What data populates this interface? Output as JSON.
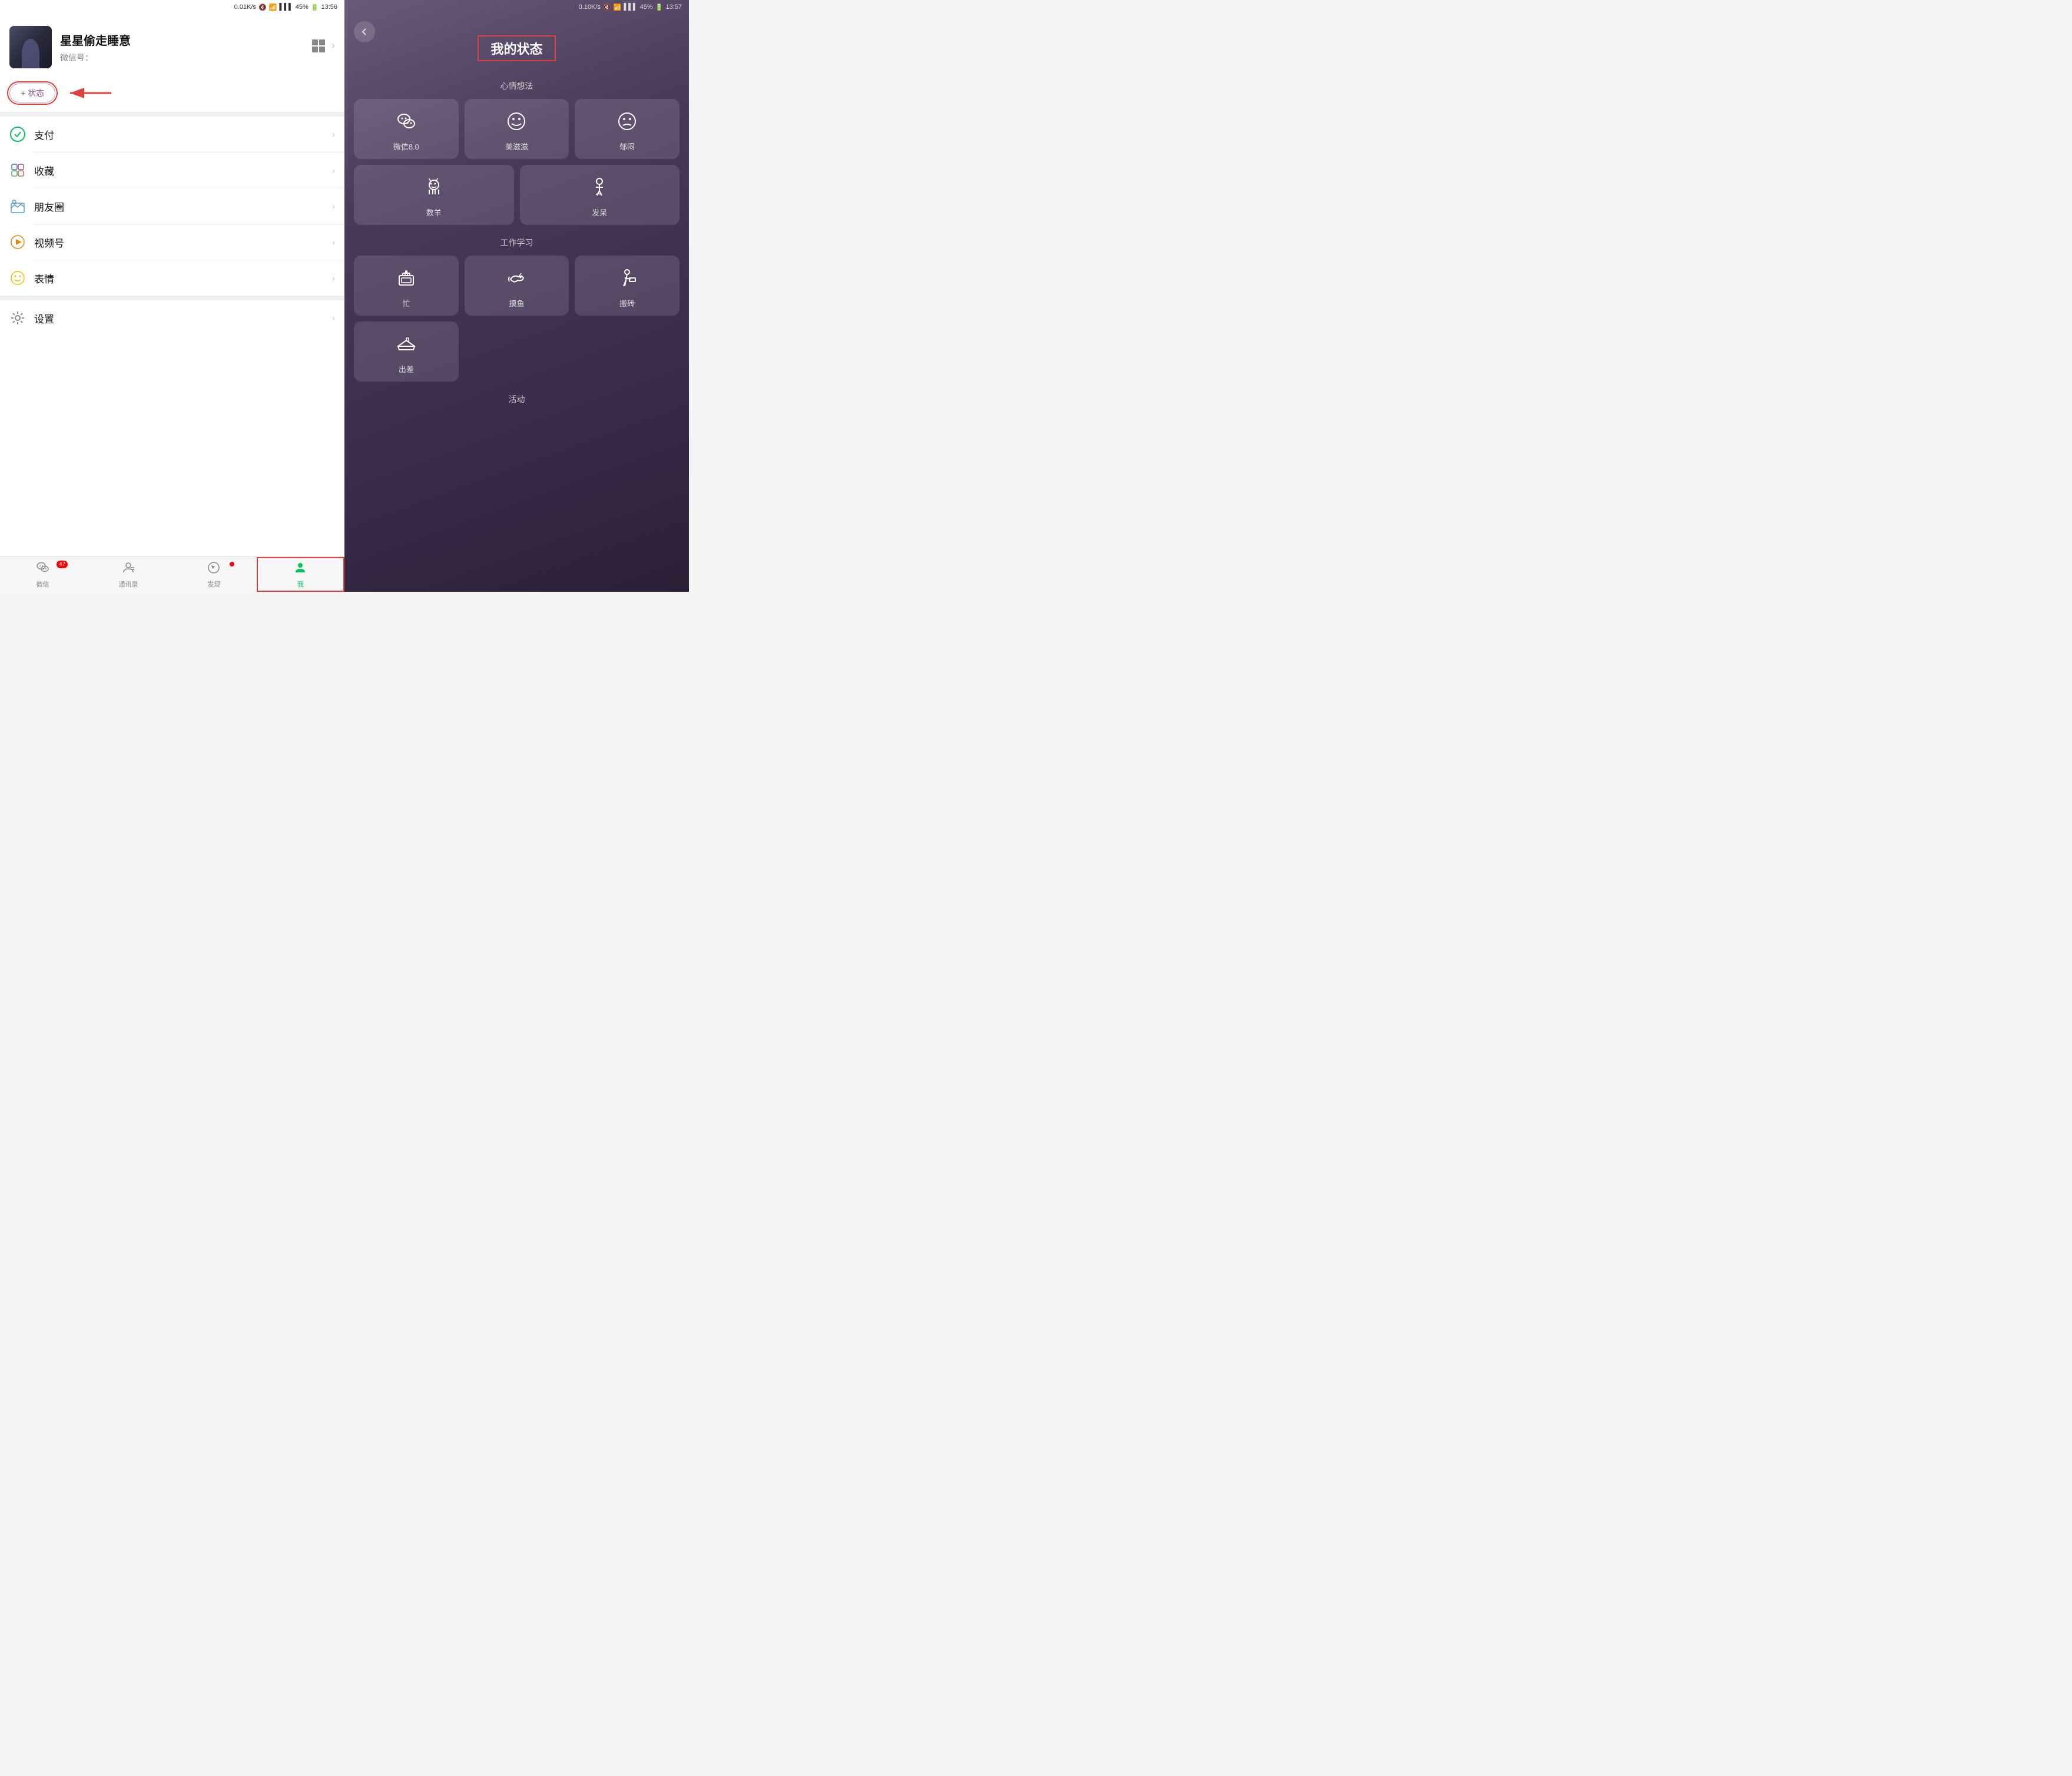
{
  "left": {
    "statusBar": {
      "speed": "0.01K/s",
      "battery": "45%",
      "time": "13:56"
    },
    "profile": {
      "name": "星星偷走睡意",
      "wechatLabel": "微信号：",
      "wechatId": ""
    },
    "statusBtn": "+ 状态",
    "menu": [
      {
        "id": "pay",
        "icon": "💚",
        "label": "支付"
      },
      {
        "id": "favorites",
        "icon": "🔷",
        "label": "收藏"
      },
      {
        "id": "moments",
        "icon": "🏔",
        "label": "朋友圈"
      },
      {
        "id": "channels",
        "icon": "▶",
        "label": "视频号"
      },
      {
        "id": "stickers",
        "icon": "😊",
        "label": "表情"
      },
      {
        "id": "settings",
        "icon": "⚙",
        "label": "设置"
      }
    ],
    "bottomNav": [
      {
        "id": "wechat",
        "label": "微信",
        "badge": "47",
        "active": false
      },
      {
        "id": "contacts",
        "label": "通讯录",
        "badge": "",
        "active": false
      },
      {
        "id": "discover",
        "label": "发现",
        "dot": true,
        "active": false
      },
      {
        "id": "me",
        "label": "我",
        "badge": "",
        "active": true
      }
    ]
  },
  "right": {
    "statusBar": {
      "speed": "0.10K/s",
      "battery": "45%",
      "time": "13:57"
    },
    "pageTitle": "我的状态",
    "sections": [
      {
        "label": "心情想法",
        "items3col": [
          {
            "id": "wechat80",
            "icon": "💬",
            "label": "微信8.0"
          },
          {
            "id": "meizi",
            "icon": "😊",
            "label": "美滋滋"
          },
          {
            "id": "yumen",
            "icon": "😕",
            "label": "郁闷"
          }
        ],
        "items2col": [
          {
            "id": "shuyang",
            "icon": "🐑",
            "label": "数羊"
          },
          {
            "id": "fazhen",
            "icon": "🧍",
            "label": "发呆"
          }
        ]
      },
      {
        "label": "工作学习",
        "items3col": [
          {
            "id": "busy",
            "icon": "💻",
            "label": "忙"
          },
          {
            "id": "moyu",
            "icon": "🎣",
            "label": "摸鱼"
          },
          {
            "id": "banzhuang",
            "icon": "🧱",
            "label": "搬砖"
          }
        ],
        "items1col": [
          {
            "id": "chuchai",
            "icon": "✈",
            "label": "出差"
          }
        ]
      },
      {
        "label": "活动",
        "items": []
      }
    ]
  }
}
